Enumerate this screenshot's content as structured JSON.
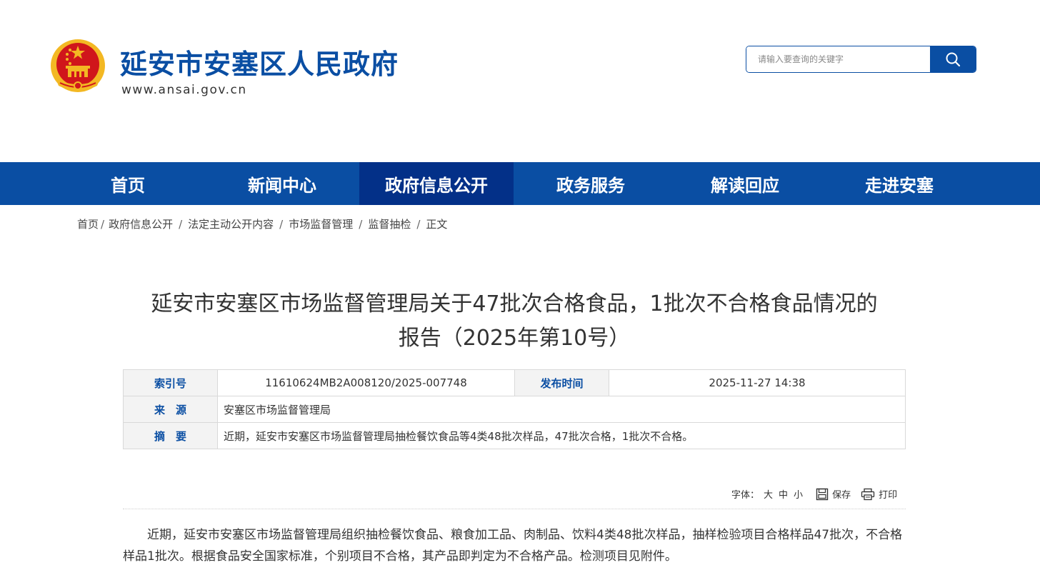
{
  "header": {
    "site_title": "延安市安塞区人民政府",
    "site_url": "www.ansai.gov.cn",
    "search_placeholder": "请输入要查询的关键字",
    "colors": {
      "brand": "#0a4ea3",
      "nav_active": "#033088",
      "emblem_red": "#d0161b",
      "emblem_gold": "#f3b823"
    }
  },
  "nav": {
    "items": [
      {
        "label": "首页",
        "active": false
      },
      {
        "label": "新闻中心",
        "active": false
      },
      {
        "label": "政府信息公开",
        "active": true
      },
      {
        "label": "政务服务",
        "active": false
      },
      {
        "label": "解读回应",
        "active": false
      },
      {
        "label": "走进安塞",
        "active": false
      }
    ]
  },
  "breadcrumb": {
    "items": [
      "首页",
      "政府信息公开",
      "法定主动公开内容",
      "市场监督管理",
      "监督抽检",
      "正文"
    ],
    "separator": "/"
  },
  "article": {
    "title_line1": "延安市安塞区市场监督管理局关于47批次合格食品，1批次不合格食品情况的",
    "title_line2": "报告（2025年第10号）",
    "meta": {
      "index_label": "索引号",
      "index_value": "11610624MB2A008120/2025-007748",
      "publish_label": "发布时间",
      "publish_value": "2025-11-27 14:38",
      "source_label": "来　源",
      "source_value": "安塞区市场监督管理局",
      "summary_label": "摘　要",
      "summary_value": "近期，延安市安塞区市场监督管理局抽检餐饮食品等4类48批次样品，47批次合格，1批次不合格。"
    },
    "tools": {
      "font_label": "字体：",
      "font_large": "大",
      "font_medium": "中",
      "font_small": "小",
      "save_label": "保存",
      "print_label": "打印"
    },
    "body": "近期，延安市安塞区市场监督管理局组织抽检餐饮食品、粮食加工品、肉制品、饮料4类48批次样品，抽样检验项目合格样品47批次，不合格样品1批次。根据食品安全国家标准，个别项目不合格，其产品即判定为不合格产品。检测项目见附件。"
  }
}
